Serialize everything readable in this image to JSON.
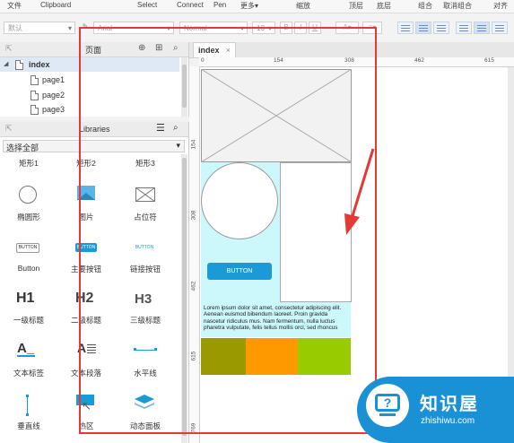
{
  "menu": {
    "file": "文件",
    "clipboard": "Clipboard",
    "select": "Select",
    "connect": "Connect",
    "pen": "Pen",
    "more": "更多▾",
    "zoom": "缩放",
    "top": "顶层",
    "bottom": "底层",
    "group": "组合",
    "ungroup": "取消组合",
    "align": "对齐"
  },
  "toolbar": {
    "style_value": "默认",
    "font_value": "Arial",
    "weight_value": "Normal",
    "size_value": "13"
  },
  "pages_panel": {
    "title": "页面",
    "root": "index",
    "pages": [
      "page1",
      "page2",
      "page3"
    ]
  },
  "libraries": {
    "title": "Libraries",
    "filter": "选择全部",
    "items": [
      {
        "label": "矩形1",
        "icon": "rectangle-icon"
      },
      {
        "label": "矩形2",
        "icon": "rectangle-icon"
      },
      {
        "label": "矩形3",
        "icon": "rectangle-icon"
      },
      {
        "label": "椭圆形",
        "icon": "ellipse-icon"
      },
      {
        "label": "图片",
        "icon": "image-icon"
      },
      {
        "label": "占位符",
        "icon": "placeholder-icon"
      },
      {
        "label": "Button",
        "icon": "button-icon",
        "preview": "BUTTON"
      },
      {
        "label": "主要按钮",
        "icon": "primary-button-icon",
        "preview": "BUTTON"
      },
      {
        "label": "链接按钮",
        "icon": "link-button-icon",
        "preview": "BUTTON"
      },
      {
        "label": "一级标题",
        "icon": "h1-icon",
        "preview": "H1"
      },
      {
        "label": "二级标题",
        "icon": "h2-icon",
        "preview": "H2"
      },
      {
        "label": "三级标题",
        "icon": "h3-icon",
        "preview": "H3"
      },
      {
        "label": "文本标签",
        "icon": "text-label-icon"
      },
      {
        "label": "文本段落",
        "icon": "text-paragraph-icon"
      },
      {
        "label": "水平线",
        "icon": "horizontal-line-icon"
      },
      {
        "label": "垂直线",
        "icon": "vertical-line-icon"
      },
      {
        "label": "热区",
        "icon": "hotspot-icon"
      },
      {
        "label": "动态面板",
        "icon": "dynamic-panel-icon"
      }
    ]
  },
  "canvas": {
    "tab": "index",
    "ruler_h": [
      "0",
      "154",
      "308",
      "462",
      "615"
    ],
    "ruler_v": [
      "154",
      "308",
      "462",
      "615",
      "769"
    ],
    "button_text": "BUTTON",
    "lorem": "Lorem ipsum dolor sit amet, consectetur adipiscing elit. Aenean euismod bibendum laoreet. Proin gravida nascetur ridiculus mus. Nam fermentum, nulla luctus pharetra vulputate, felis tellus mollis orci, sed rhoncus",
    "colors": {
      "cyan_bg": "#ccf7fb",
      "button": "#1a9bd7",
      "olive": "#9a9a00",
      "orange": "#ff9900",
      "green": "#99cc00",
      "annotation": "#e53935"
    }
  },
  "watermark": {
    "name": "知识屋",
    "url": "zhishiwu.com"
  }
}
